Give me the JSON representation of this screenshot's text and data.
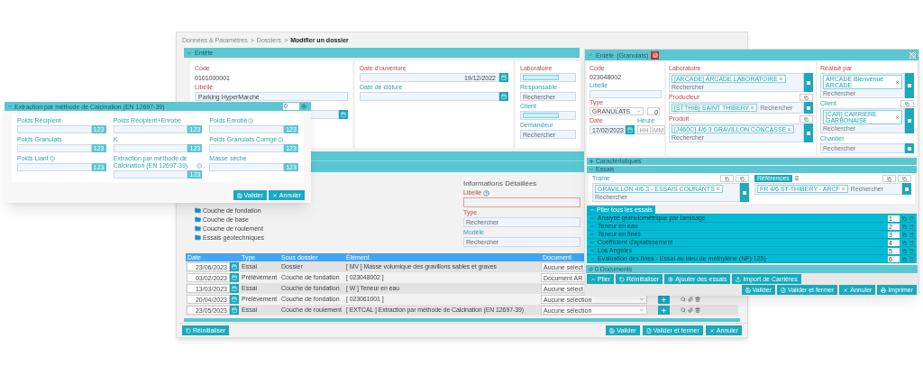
{
  "breadcrumb": {
    "items": [
      {
        "label": "Données & Paramètres",
        "current": false
      },
      {
        "label": "Dossiers",
        "current": false
      },
      {
        "label": "Modifier un dossier",
        "current": true
      }
    ],
    "separators": [
      ">",
      ">"
    ]
  },
  "header_section": {
    "title": "Entête",
    "expanded": true
  },
  "dossier_cards": [
    [
      {
        "kind": "text",
        "label": "Code",
        "required": true,
        "value": "0101000001"
      },
      {
        "kind": "input",
        "label": "Libellé",
        "required": true,
        "value": "Parking HyperMarché"
      },
      {
        "kind": "date"
      }
    ],
    [
      {
        "kind": "date",
        "label": "Date d'ouverture",
        "required": true,
        "value": "19/12/2022"
      },
      {
        "kind": "date",
        "label": "Date de clôture",
        "required": false
      }
    ],
    [
      {
        "kind": "chip",
        "label": "Laboratoire",
        "required": true
      },
      {
        "kind": "search",
        "label": "Responsable",
        "required": false,
        "placeholder": "Rechercher"
      },
      {
        "kind": "chip",
        "label": "Client",
        "required": false
      },
      {
        "kind": "search",
        "label": "Demandeur",
        "required": false,
        "placeholder": "Rechercher"
      }
    ]
  ],
  "tree": [
    {
      "label": "Couche de fondation"
    },
    {
      "label": "Couche de base"
    },
    {
      "label": "Couche de roulement"
    },
    {
      "label": "Essais géotechniques"
    }
  ],
  "details": {
    "title": "Informations Détaillées",
    "fields": [
      {
        "label": "Libellé",
        "required": true,
        "help": true
      },
      {
        "label": "Type",
        "required": true,
        "help": false,
        "placeholder": "Rechercher"
      },
      {
        "label": "Modèle",
        "required": false,
        "help": false,
        "placeholder": "Rechercher"
      }
    ]
  },
  "table": {
    "columns": [
      "Date",
      "Type",
      "Sous dossier",
      "Élément",
      "Document"
    ],
    "rows": [
      {
        "date": "23/06/2023",
        "type": "Essai",
        "sous_dossier": "Dossier",
        "element": "[ MV ] Masse volumique des gravillons sables et graves",
        "document": "Aucune sélect",
        "actions": false
      },
      {
        "date": "03/02/2023",
        "type": "Prélèvement",
        "sous_dossier": "Couche de fondation",
        "element": "[ 023048002 ]",
        "document": "Document AR",
        "actions": false
      },
      {
        "date": "13/03/2023",
        "type": "Essai",
        "sous_dossier": "Couche de fondation",
        "element": "[ W ] Teneur en eau",
        "document": "Aucune sélect",
        "actions": false
      },
      {
        "date": "20/04/2023",
        "type": "Prélèvement",
        "sous_dossier": "Couche de fondation",
        "element": "[ 023061001 ]",
        "document": "Aucune sélection",
        "actions": true
      },
      {
        "date": "23/05/2023",
        "type": "Essai",
        "sous_dossier": "Couche de roulement",
        "element": "[ EXTCAL ] Extraction par méthode de Calcination (EN 12697-39)",
        "document": "Aucune sélection",
        "actions": true
      }
    ]
  },
  "footer": {
    "left": [
      {
        "label": "Réinitialiser",
        "kind": "reset"
      }
    ],
    "right": [
      {
        "label": "Valider",
        "kind": "save"
      },
      {
        "label": "Valider et fermer",
        "kind": "save_close"
      },
      {
        "label": "Annuler",
        "kind": "cancel"
      }
    ]
  },
  "dialog": {
    "title": "Extraction par méthode de Calcination (EN 12697-39)",
    "header_value": "0",
    "fields": [
      {
        "label": "Poids Récipient",
        "info": false,
        "button": "123"
      },
      {
        "label": "Poids Récipient+Enrobé",
        "info": false,
        "button": "123"
      },
      {
        "label": "Poids Enrobé",
        "info": true,
        "button": "123"
      },
      {
        "label": "Poids Granulats",
        "info": false,
        "button": "123"
      },
      {
        "label": "K",
        "info": false,
        "button": "123"
      },
      {
        "label": "Poids Granulats Corrigé",
        "info": true,
        "button": "123"
      },
      {
        "label": "Poids Liant",
        "info": true,
        "button": "123"
      },
      {
        "label": "Extraction par méthode de Calcination (EN 12697-39)",
        "info": true,
        "button": "123"
      },
      {
        "label": "Masse sèche",
        "info": false,
        "button": "123"
      }
    ],
    "buttons": [
      {
        "label": "Valider",
        "kind": "save"
      },
      {
        "label": "Annuler",
        "kind": "cancel"
      }
    ]
  },
  "sample": {
    "title": "Entête",
    "subtitle": "(Granulats)",
    "expanded": true,
    "code": {
      "label": "Code",
      "required": true,
      "value": "023048002"
    },
    "libelle": {
      "label": "Libellé",
      "required": false
    },
    "type": {
      "label": "Type",
      "required": true,
      "value": "GRANULATS",
      "count": "0"
    },
    "date": {
      "label": "Date",
      "required": true,
      "value": "17/02/2023"
    },
    "heure": {
      "label": "Heure",
      "required": false,
      "fields": [
        {
          "placeholder": "HH"
        },
        {
          "placeholder": "MM"
        }
      ]
    },
    "column_2": [
      {
        "label": "Laboratoire",
        "required": true,
        "tags": [
          "[ARCADE] ARCADE LABORATOIRE"
        ],
        "placeholder": "Rechercher",
        "extra_button": false
      },
      {
        "label": "Producteur",
        "required": true,
        "tags": [
          "[STTHIB] SAINT THIBERY"
        ],
        "placeholder": "Rechercher",
        "extra_button": true
      },
      {
        "label": "Produit",
        "required": true,
        "tags": [
          "[J460C] 4/6.3 GRAVILLON CONCASSE"
        ],
        "placeholder": "Rechercher",
        "extra_button": true
      }
    ],
    "column_3": [
      {
        "label": "Réalisé par",
        "required": true,
        "tags": [
          "ARCADE Bienvenue ARCADE"
        ],
        "placeholder": "Rechercher",
        "extra_button": false
      },
      {
        "label": "Client",
        "required": false,
        "tags": [
          "[CAR] CARRIERE GARBONAISE"
        ],
        "placeholder": "Rechercher",
        "extra_button": true
      },
      {
        "label": "Chantier",
        "required": false,
        "placeholder": "Rechercher",
        "extra_button": false
      }
    ],
    "sections": [
      {
        "title": "Caractéristiques",
        "expanded": false
      },
      {
        "title": "Essais",
        "expanded": true
      }
    ],
    "trame": {
      "label": "Trame",
      "tags": [
        "GRAVILLON 4/6.3 - ESSAIS COURANTS"
      ],
      "placeholder": "Rechercher"
    },
    "references": {
      "label": "Références",
      "tags": [
        "FR 4/6 ST-THIBERY - ARCF"
      ],
      "placeholder": "Rechercher"
    },
    "fold_all": "Plier tous les essais",
    "tests": [
      {
        "name": "Analyse granulométrique par tamisage",
        "order": "1",
        "expanded": true
      },
      {
        "name": "Teneur en eau",
        "order": "2",
        "expanded": true
      },
      {
        "name": "Teneur en fines",
        "order": "3",
        "expanded": true
      },
      {
        "name": "Coefficient d'aplatissement",
        "order": "4",
        "expanded": true
      },
      {
        "name": "Los Angeles",
        "order": "5",
        "expanded": true
      },
      {
        "name": "Evaluation des fines - Essai au bleu de méthylène (NF) 125)",
        "order": "6",
        "expanded": true
      }
    ],
    "documents": "0 Documents",
    "left_buttons": [
      {
        "label": "Plier",
        "kind": "fold"
      },
      {
        "label": "Réinitialiser",
        "kind": "reset"
      },
      {
        "label": "Ajouter des essais",
        "kind": "add"
      },
      {
        "label": "Import de Carrières",
        "kind": "import"
      }
    ],
    "right_buttons": [
      {
        "label": "Valider",
        "kind": "save"
      },
      {
        "label": "Valider et fermer",
        "kind": "save_close"
      },
      {
        "label": "Annuler",
        "kind": "cancel"
      },
      {
        "label": "Imprimer",
        "kind": "print"
      }
    ]
  }
}
